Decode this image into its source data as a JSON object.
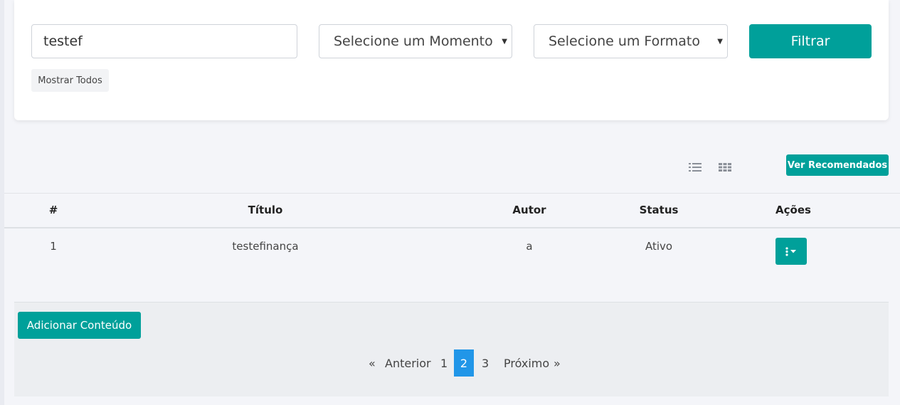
{
  "filters": {
    "search_value": "testef",
    "momento_select": "Selecione um Momento",
    "formato_select": "Selecione um Formato",
    "filter_button": "Filtrar",
    "show_all_button": "Mostrar Todos"
  },
  "toolbar": {
    "list_view_icon": "list-icon",
    "grid_view_icon": "grid-icon",
    "recommend_button": "Ver Recomendados"
  },
  "table": {
    "columns": [
      "#",
      "Título",
      "Autor",
      "Status",
      "Ações"
    ],
    "rows": [
      {
        "num": "1",
        "title": "testefinança",
        "author": "a",
        "status": "Ativo"
      }
    ],
    "actions_icon": "more-vertical-caret-icon"
  },
  "footer": {
    "add_button": "Adicionar Conteúdo",
    "pagination": {
      "prev_symbol": "«",
      "prev_label": "Anterior",
      "pages": [
        "1",
        "2",
        "3"
      ],
      "current_page": "2",
      "next_label": "Próximo",
      "next_symbol": "»"
    }
  },
  "colors": {
    "accent": "#00a09a",
    "page_active": "#2196e8",
    "background": "#f4f5f9"
  }
}
